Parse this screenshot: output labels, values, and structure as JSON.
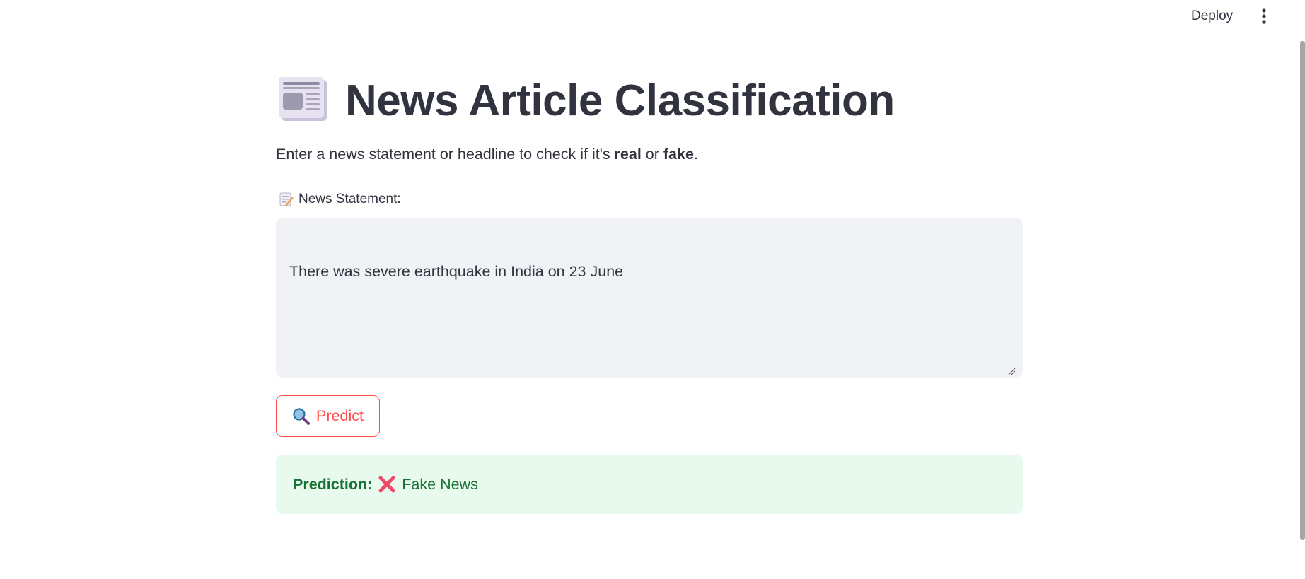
{
  "header": {
    "deploy_label": "Deploy",
    "menu_icon": "vertical-ellipsis-icon"
  },
  "page": {
    "title": "News Article Classification",
    "title_icon": "newspaper-icon",
    "subtitle_parts": {
      "pre": "Enter a news statement or headline to check if it's ",
      "real": "real",
      "mid": " or ",
      "fake": "fake",
      "end": "."
    }
  },
  "input": {
    "label_icon": "memo-icon",
    "label": "News Statement:",
    "value": "There was severe earthquake in India on 23 June"
  },
  "predict_button": {
    "icon": "magnifying-glass-icon",
    "label": "Predict"
  },
  "result": {
    "label": "Prediction:",
    "icon": "cross-mark-icon",
    "value": "Fake News"
  },
  "colors": {
    "accent": "#ff4b4b",
    "success_bg": "#e8f9ee",
    "success_text": "#177233",
    "input_bg": "#f0f2f6",
    "text": "#31333f"
  }
}
